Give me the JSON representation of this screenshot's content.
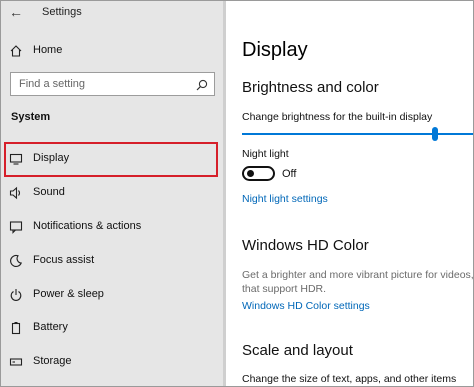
{
  "window": {
    "title": "Settings"
  },
  "nav": {
    "home_label": "Home",
    "search_placeholder": "Find a setting",
    "section_label": "System",
    "items": [
      {
        "label": "Display",
        "icon": "monitor-icon",
        "selected": true
      },
      {
        "label": "Sound",
        "icon": "speaker-icon"
      },
      {
        "label": "Notifications & actions",
        "icon": "notification-icon"
      },
      {
        "label": "Focus assist",
        "icon": "moon-icon"
      },
      {
        "label": "Power & sleep",
        "icon": "power-icon"
      },
      {
        "label": "Battery",
        "icon": "battery-icon"
      },
      {
        "label": "Storage",
        "icon": "storage-icon"
      }
    ]
  },
  "main": {
    "title": "Display",
    "brightness": {
      "heading": "Brightness and color",
      "slider_label": "Change brightness for the built-in display",
      "slider_value_fraction": 0.84,
      "night_light_label": "Night light",
      "night_light_state": "Off",
      "night_light_link": "Night light settings"
    },
    "hdr": {
      "heading": "Windows HD Color",
      "description_line1": "Get a brighter and more vibrant picture for videos, ga",
      "description_line2": "that support HDR.",
      "link": "Windows HD Color settings"
    },
    "scale": {
      "heading": "Scale and layout",
      "description": "Change the size of text, apps, and other items"
    }
  },
  "colors": {
    "accent": "#0078d7",
    "highlight_border": "#d61f2a",
    "nav_bg": "#e6e6e6",
    "link": "#0067b8"
  }
}
